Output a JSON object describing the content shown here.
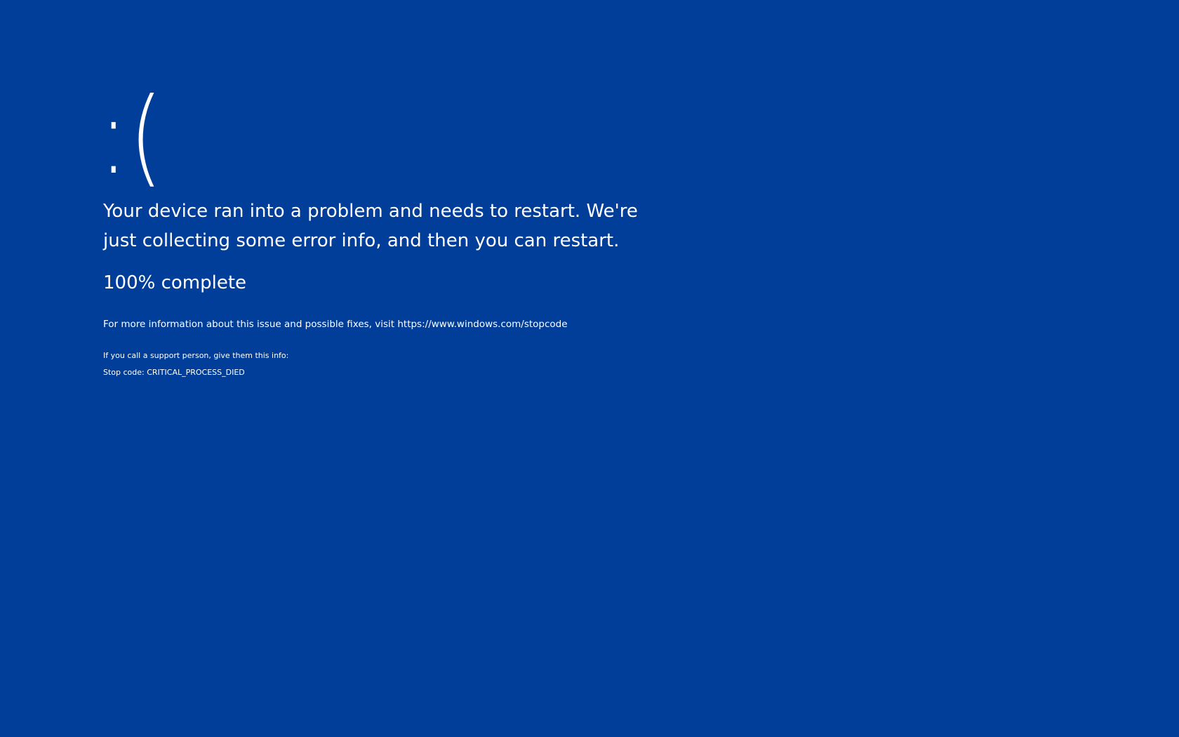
{
  "screen": {
    "background_color": "#013e99",
    "text_color": "#ffffff",
    "sad_face": ":(",
    "headline": "Your device ran into a problem and needs to restart. We're just collecting some error info, and then you can restart.",
    "progress": {
      "percent": 100,
      "text": "100% complete"
    },
    "info_text": "For more information about this issue and possible fixes, visit https://www.windows.com/stopcode",
    "support_text": "If you call a support person, give them this info:",
    "stop_code_text": "Stop code: CRITICAL_PROCESS_DIED"
  }
}
